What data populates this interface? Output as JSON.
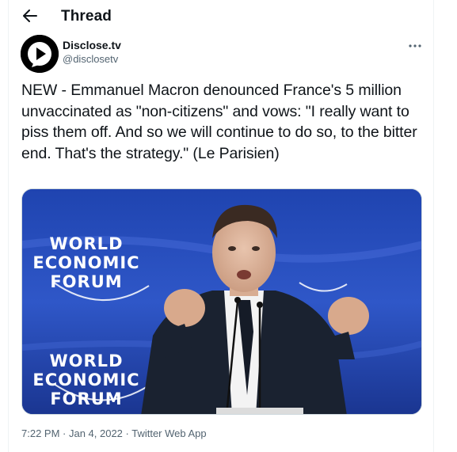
{
  "header": {
    "title": "Thread",
    "back_icon": "arrow-left-icon"
  },
  "tweet": {
    "author": {
      "name": "Disclose.tv",
      "handle": "@disclosetv",
      "avatar_icon": "disclose-logo-icon"
    },
    "more_icon": "more-horizontal-icon",
    "text": "NEW - Emmanuel Macron denounced France's 5 million unvaccinated as \"non-citizens\" and vows: \"I really want to piss them off. And so we will continue to do so, to the bitter end. That's the strategy.\" (Le Parisien)",
    "media": {
      "logo_lines": [
        "WORLD",
        "ECONOMIC",
        "FORUM"
      ]
    },
    "meta": "7:22 PM · Jan 4, 2022 · Twitter Web App"
  },
  "colors": {
    "text": "#0f1419",
    "secondary": "#536471",
    "border": "#eff3f4",
    "media_blue": "#2848b2"
  }
}
